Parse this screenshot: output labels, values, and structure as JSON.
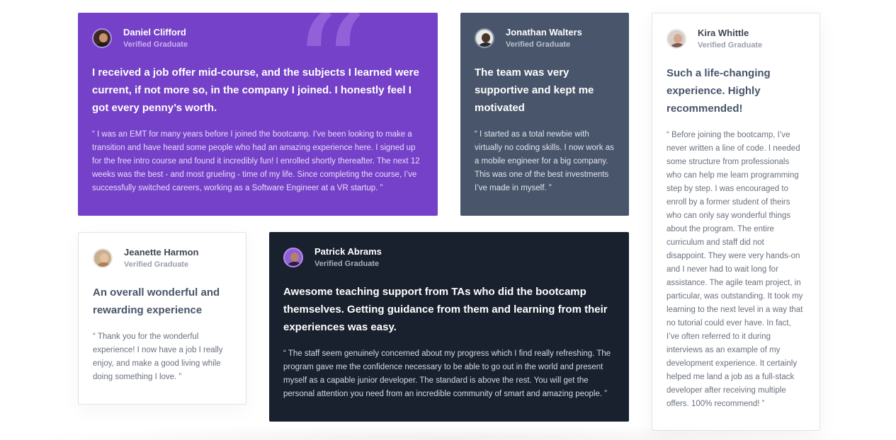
{
  "testimonials": [
    {
      "name": "Daniel Clifford",
      "status": "Verified Graduate",
      "avatar_icon": "person-avatar",
      "headline": "I received a job offer mid-course, and the subjects I learned were current, if not more so, in the company I joined. I honestly feel I got every penny’s worth.",
      "quote": "“ I was an EMT for many years before I joined the bootcamp. I’ve been looking to make a transition and have heard some people who had an amazing experience here. I signed up for the free intro course and found it incredibly fun! I enrolled shortly thereafter. The next 12 weeks was the best - and most grueling - time of my life. Since completing the course, I’ve successfully switched careers, working as a Software Engineer at a VR startup. ”",
      "background": "#7541c8",
      "decoration": "“"
    },
    {
      "name": "Jonathan Walters",
      "status": "Verified Graduate",
      "avatar_icon": "person-avatar",
      "headline": "The team was very supportive and kept me motivated",
      "quote": "“ I started as a total newbie with virtually no coding skills. I now work as a mobile engineer for a big company. This was one of the best investments I’ve made in myself. ”",
      "background": "#48556a"
    },
    {
      "name": "Kira Whittle",
      "status": "Verified Graduate",
      "avatar_icon": "person-avatar",
      "headline": "Such a life-changing experience. Highly recommended!",
      "quote": "“ Before joining the bootcamp, I’ve never written a line of code. I needed some structure from professionals who can help me learn programming step by step. I was encouraged to enroll by a former student of theirs who can only say wonderful things about the program. The entire curriculum and staff did not disappoint. They were very hands-on and I never had to wait long for assistance. The agile team project, in particular, was outstanding. It took my learning to the next level in a way that no tutorial could ever have. In fact, I’ve often referred to it during interviews as an example of my development experience. It certainly helped me land a job as a full-stack developer after receiving multiple offers. 100% recommend! ”",
      "background": "#ffffff"
    },
    {
      "name": "Jeanette Harmon",
      "status": "Verified Graduate",
      "avatar_icon": "person-avatar",
      "headline": "An overall wonderful and rewarding experience",
      "quote": "“ Thank you for the wonderful experience! I now have a job I really enjoy, and make a good living while doing something I love. ”",
      "background": "#ffffff"
    },
    {
      "name": "Patrick Abrams",
      "status": "Verified Graduate",
      "avatar_icon": "person-avatar",
      "headline": "Awesome teaching support from TAs who did the bootcamp themselves. Getting guidance from them and learning from their experiences was easy.",
      "quote": "“ The staff seem genuinely concerned about my progress which I find really refreshing. The program gave me the confidence necessary to be able to go out in the world and present myself as a capable junior developer. The standard is above the rest. You will get the personal attention you need from an incredible community of smart and amazing people. ”",
      "background": "#19212e"
    }
  ]
}
